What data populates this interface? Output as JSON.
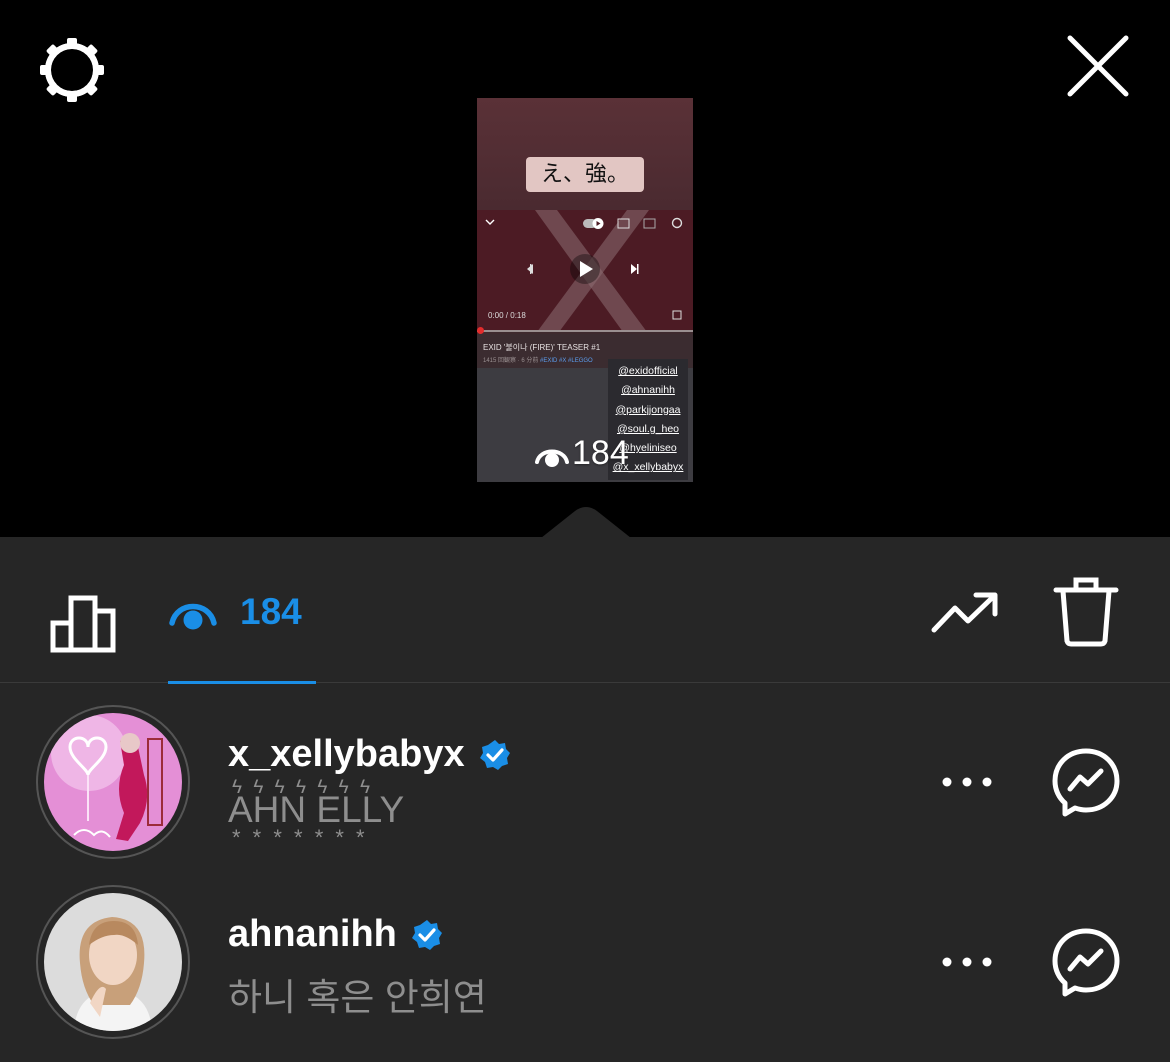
{
  "story": {
    "caption": "え、強。",
    "video": {
      "time": "0:00 / 0:18",
      "title": "EXID '불이나 (FIRE)' TEASER #1",
      "meta": "1415 回観察 · 6 分前",
      "tags": "#EXID #X #LEGGO"
    },
    "mentions": [
      "@exidofficial",
      "@ahnanihh",
      "@parkjjongaa",
      "@soul.g_heo",
      "@hyeliniseo",
      "@x_xellybabyx"
    ],
    "views": "184"
  },
  "toolbar": {
    "viewers_count": "184"
  },
  "viewers": [
    {
      "username": "x_xellybabyx",
      "deco_top": "ϟ ϟ ϟ  ϟ ϟ ϟ ϟ",
      "full_name": "AHN ELLY",
      "deco_bottom": "* * *  * * * *",
      "verified": true
    },
    {
      "username": "ahnanihh",
      "full_name": "하니 혹은 안희연",
      "verified": true
    }
  ],
  "colors": {
    "accent": "#1a8ee6",
    "sheet": "#262626",
    "secondary_text": "#8e8e8e"
  },
  "icons": [
    "settings-icon",
    "close-icon",
    "insights-icon",
    "eye-icon",
    "promote-icon",
    "trash-icon",
    "verified-icon",
    "more-icon",
    "messenger-icon"
  ]
}
